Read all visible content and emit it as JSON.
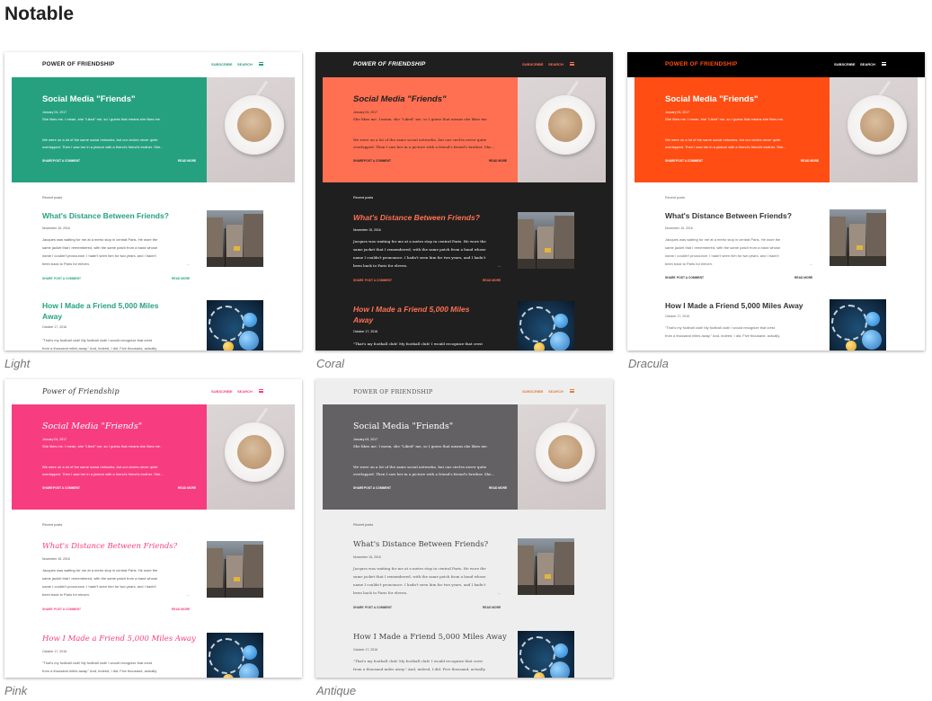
{
  "page": {
    "title": "Notable"
  },
  "preview": {
    "brand_upper": "POWER OF FRIENDSHIP",
    "brand_title": "Power of Friendship",
    "subscribe": "SUBSCRIBE",
    "search": "SEARCH",
    "hero": {
      "title": "Social Media \"Friends\"",
      "date": "January 04, 2017",
      "line1": "She likes me. I mean, she \"Liked\" me, so I guess that means she likes me.",
      "line2": "We were on a lot of the same social networks, but our circles never quite",
      "line3": "overlapped. Then I saw her in a picture with a friend's friend's brother. She...",
      "share": "SHARE",
      "post_comment": "POST A COMMENT",
      "read_more": "READ MORE"
    },
    "recent_posts": "Recent posts",
    "recent_posts_lower": "Recent posts",
    "post1": {
      "title": "What's Distance Between Friends?",
      "date": "November 15, 2016",
      "line1": "Jacques was waiting for me at a metro stop in central Paris. He wore the",
      "line2": "same jacket that I remembered, with the same patch from a band whose",
      "line3": "name I couldn't pronounce. I hadn't seen him for two years, and I hadn't",
      "line4": "been back to Paris for eleven.",
      "dots": "...",
      "share": "SHARE",
      "post_comment": "POST A COMMENT",
      "read_more": "READ MORE"
    },
    "post2": {
      "title_line1": "How I Made a Friend 5,000 Miles",
      "title_line2": "Away",
      "title_full": "How I Made a Friend 5,000 Miles Away",
      "date": "October 17, 2016",
      "line1": "\"That's my football club! My football club! I would recognize that crest",
      "line2": "from a thousand miles away.\" And, indeed, I did. Five thousand, actually."
    }
  },
  "themes": [
    {
      "label": "Light",
      "bg": "#ffffff",
      "bar": "#ffffff",
      "brand": "#212121",
      "nav": "#26a17f",
      "hero": "#26a17f",
      "hero_text": "#ffffff",
      "accent": "#26a17f",
      "text": "#555555"
    },
    {
      "label": "Coral",
      "bg": "#1f1f1f",
      "bar": "#1f1f1f",
      "brand": "#ffffff",
      "nav": "#ff7052",
      "hero": "#ff7052",
      "hero_text": "#1f1f1f",
      "accent": "#ff7052",
      "text": "#ffffff"
    },
    {
      "label": "Dracula",
      "bg": "#ffffff",
      "bar": "#000000",
      "brand": "#ff4d14",
      "nav": "#ffffff",
      "hero": "#ff4d14",
      "hero_text": "#ffffff",
      "accent": "#333333",
      "text": "#666666"
    },
    {
      "label": "Pink",
      "bg": "#ffffff",
      "bar": "#ffffff",
      "brand": "#333333",
      "nav": "#f73d7f",
      "hero": "#f73d7f",
      "hero_text": "#ffffff",
      "accent": "#f73d7f",
      "text": "#555555"
    },
    {
      "label": "Antique",
      "bg": "#eeeeee",
      "bar": "#eeeeee",
      "brand": "#555555",
      "nav": "#e07e3b",
      "hero": "#636163",
      "hero_text": "#ffffff",
      "accent": "#444444",
      "text": "#555555"
    }
  ]
}
